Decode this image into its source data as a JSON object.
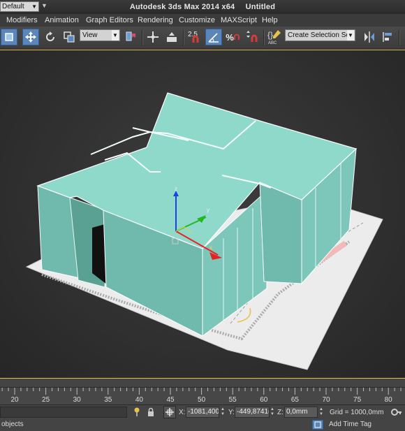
{
  "title": {
    "app": "Autodesk 3ds Max  2014 x64",
    "document": "Untitled"
  },
  "workspace": {
    "value": "Default"
  },
  "menu": [
    "Modifiers",
    "Animation",
    "Graph Editors",
    "Rendering",
    "Customize",
    "MAXScript",
    "Help"
  ],
  "toolbar": {
    "reference_coord": "View",
    "snap_angle_label": "2.5",
    "percent_snap_label": "%",
    "abc_label": "ABC",
    "selection_set_placeholder": "Create Selection Se"
  },
  "gizmo": {
    "x": "x",
    "y": "y",
    "z": "z"
  },
  "timeline": {
    "ticks": [
      "20",
      "25",
      "30",
      "35",
      "40",
      "45",
      "50",
      "55",
      "60",
      "65",
      "70",
      "75",
      "80"
    ]
  },
  "status": {
    "x_label": "X:",
    "x_value": "-1081,400(",
    "y_label": "Y:",
    "y_value": "-449,8741(",
    "z_label": "Z:",
    "z_value": "0,0mm",
    "grid": "Grid = 1000,0mm",
    "prompt": "objects",
    "add_time_tag": "Add Time Tag"
  },
  "colors": {
    "accent": "#5d86b8",
    "viewport_border": "#e9c23a",
    "model": "#8fd9cb",
    "model_side": "#6fb9ad"
  }
}
